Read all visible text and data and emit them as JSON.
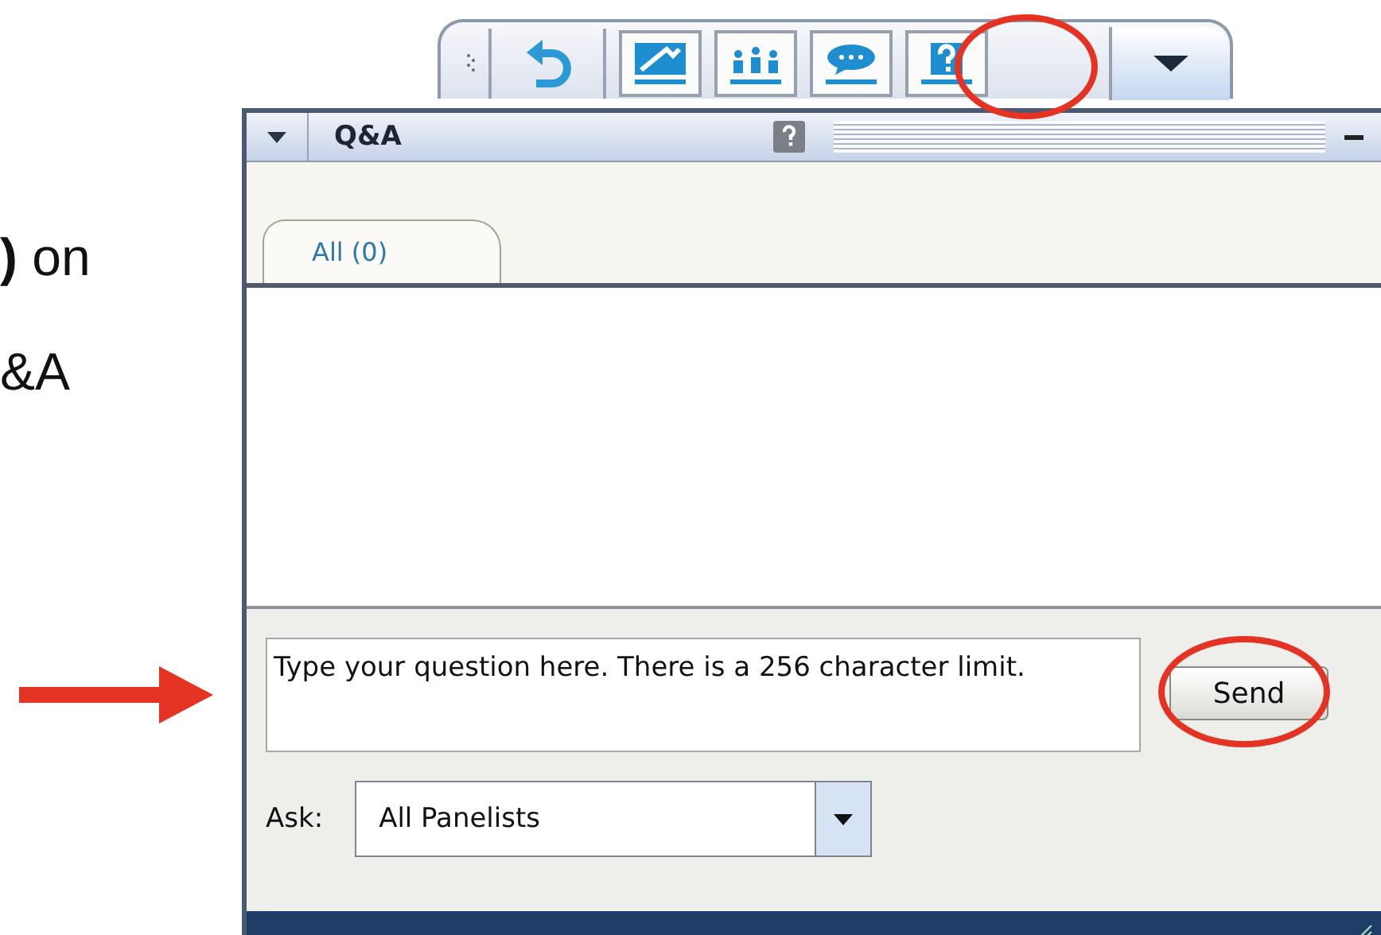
{
  "slide_text": [
    {
      "text": "**)** on"
    },
    {
      "text": "&A"
    }
  ],
  "panel": {
    "title": "Q&A",
    "tabs": [
      {
        "label": "All (0)",
        "selected": true
      }
    ],
    "question": {
      "placeholder": "Type your question here. There is a 256 character limit."
    },
    "send_button": "Send",
    "ask": {
      "label": "Ask:",
      "value": "All Panelists"
    }
  }
}
